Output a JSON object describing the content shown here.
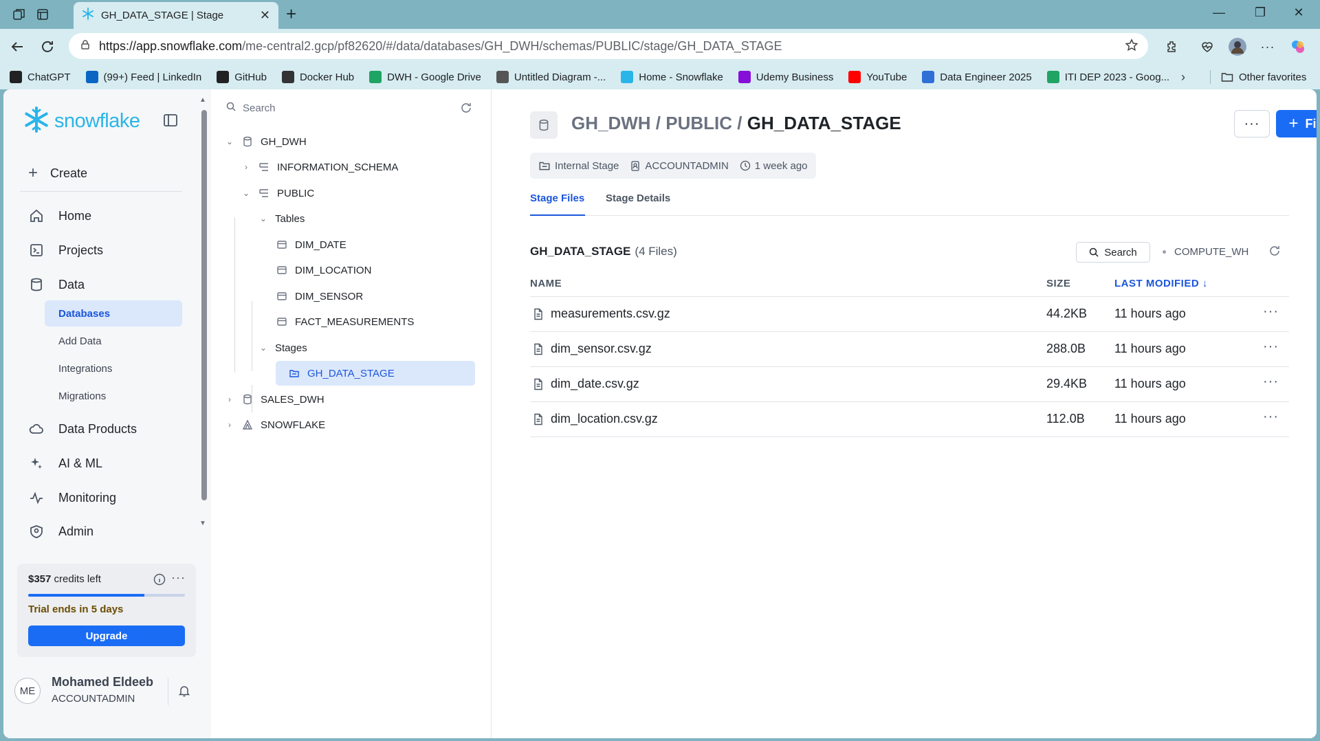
{
  "browser": {
    "tab_title": "GH_DATA_STAGE | Stage",
    "url_host": "https://app.snowflake.com",
    "url_path": "/me-central2.gcp/pf82620/#/data/databases/GH_DWH/schemas/PUBLIC/stage/GH_DATA_STAGE",
    "bookmarks": [
      {
        "label": "ChatGPT",
        "icon": "chatgpt-icon",
        "color": "#222222"
      },
      {
        "label": "(99+) Feed | LinkedIn",
        "icon": "linkedin-icon",
        "color": "#0a66c2"
      },
      {
        "label": "GitHub",
        "icon": "github-icon",
        "color": "#222222"
      },
      {
        "label": "Docker Hub",
        "icon": "docker-icon",
        "color": "#333333"
      },
      {
        "label": "DWH - Google Drive",
        "icon": "drive-icon",
        "color": "#1fa463"
      },
      {
        "label": "Untitled Diagram -...",
        "icon": "diagram-icon",
        "color": "#555555"
      },
      {
        "label": "Home - Snowflake",
        "icon": "snowflake-icon",
        "color": "#29b5e8"
      },
      {
        "label": "Udemy Business",
        "icon": "udemy-icon",
        "color": "#8710d8"
      },
      {
        "label": "YouTube",
        "icon": "youtube-icon",
        "color": "#ff0000"
      },
      {
        "label": "Data Engineer 2025",
        "icon": "doc-icon",
        "color": "#2f6fd6"
      },
      {
        "label": "ITI DEP 2023 - Goog...",
        "icon": "drive-icon",
        "color": "#1fa463"
      }
    ],
    "other_favorites": "Other favorites"
  },
  "nav": {
    "logo": "snowflake",
    "create": "Create",
    "items": [
      {
        "label": "Home",
        "icon": "home-icon"
      },
      {
        "label": "Projects",
        "icon": "projects-icon"
      },
      {
        "label": "Data",
        "icon": "database-icon"
      },
      {
        "label": "Data Products",
        "icon": "cloud-icon"
      },
      {
        "label": "AI & ML",
        "icon": "sparkle-icon"
      },
      {
        "label": "Monitoring",
        "icon": "activity-icon"
      },
      {
        "label": "Admin",
        "icon": "admin-icon"
      }
    ],
    "data_sub": [
      "Databases",
      "Add Data",
      "Integrations",
      "Migrations"
    ],
    "credits_amount": "$357",
    "credits_text": "credits left",
    "credits_fraction": 0.74,
    "trial": "Trial ends in 5 days",
    "upgrade": "Upgrade",
    "user_initials": "ME",
    "user_name": "Mohamed Eldeeb",
    "user_role": "ACCOUNTADMIN"
  },
  "tree": {
    "search_placeholder": "Search",
    "nodes": {
      "gh_dwh": "GH_DWH",
      "info_schema": "INFORMATION_SCHEMA",
      "public": "PUBLIC",
      "tables": "Tables",
      "dim_date": "DIM_DATE",
      "dim_location": "DIM_LOCATION",
      "dim_sensor": "DIM_SENSOR",
      "fact_measurements": "FACT_MEASUREMENTS",
      "stages": "Stages",
      "gh_data_stage": "GH_DATA_STAGE",
      "sales_dwh": "SALES_DWH",
      "snowflake": "SNOWFLAKE"
    }
  },
  "main": {
    "crumb_db": "GH_DWH",
    "crumb_schema": "PUBLIC",
    "crumb_stage": "GH_DATA_STAGE",
    "sep": "/",
    "files_button": "Files",
    "meta": {
      "type": "Internal Stage",
      "owner": "ACCOUNTADMIN",
      "created": "1 week ago"
    },
    "tabs": [
      "Stage Files",
      "Stage Details"
    ],
    "files_title": "GH_DATA_STAGE",
    "files_count": "(4 Files)",
    "search_button": "Search",
    "warehouse": "COMPUTE_WH",
    "columns": {
      "name": "NAME",
      "size": "SIZE",
      "modified": "LAST MODIFIED"
    },
    "files": [
      {
        "name": "measurements.csv.gz",
        "size": "44.2KB",
        "modified": "11 hours ago"
      },
      {
        "name": "dim_sensor.csv.gz",
        "size": "288.0B",
        "modified": "11 hours ago"
      },
      {
        "name": "dim_date.csv.gz",
        "size": "29.4KB",
        "modified": "11 hours ago"
      },
      {
        "name": "dim_location.csv.gz",
        "size": "112.0B",
        "modified": "11 hours ago"
      }
    ]
  },
  "colors": {
    "accent": "#1a6cf5",
    "brand": "#29b5e8",
    "chrome": "#7fb3c0"
  }
}
